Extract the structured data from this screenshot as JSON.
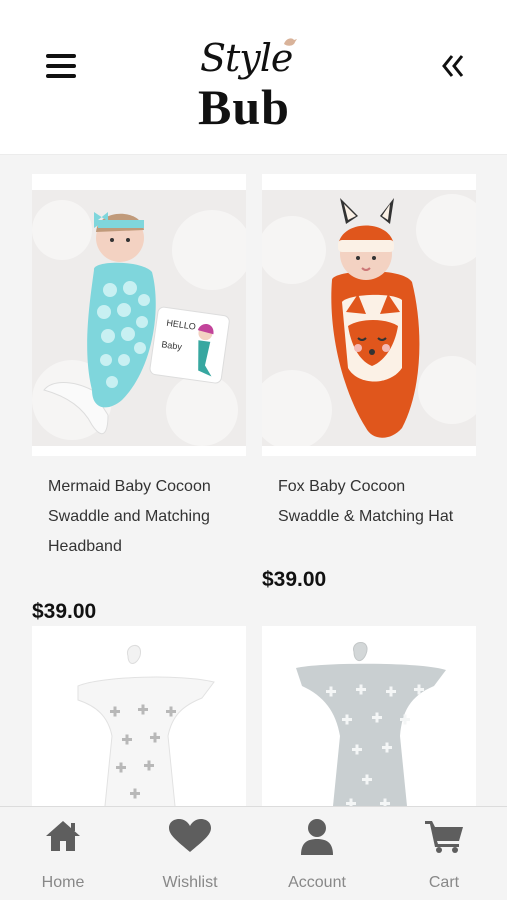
{
  "header": {
    "logo_script": "Style",
    "logo_bold": "Bub",
    "menu_icon": "hamburger-icon",
    "back_icon": "double-chevron-left-icon"
  },
  "products": [
    {
      "title_lines": [
        "Mermaid Baby Cocoon",
        "Swaddle and Matching",
        "Headband"
      ],
      "price": "$39.00",
      "image": "mermaid-cocoon-image",
      "card_label": "HELLO",
      "card_label2": "Baby"
    },
    {
      "title_lines": [
        "Fox Baby Cocoon",
        "Swaddle & Matching Hat"
      ],
      "price": "$39.00",
      "image": "fox-cocoon-image"
    },
    {
      "image": "white-star-sleeper-image"
    },
    {
      "image": "grey-star-sleeper-image"
    }
  ],
  "tabbar": {
    "items": [
      {
        "label": "Home",
        "icon": "home-icon"
      },
      {
        "label": "Wishlist",
        "icon": "heart-icon"
      },
      {
        "label": "Account",
        "icon": "user-icon"
      },
      {
        "label": "Cart",
        "icon": "cart-icon"
      }
    ]
  },
  "colors": {
    "teal": "#7fd6dc",
    "fox_orange": "#e0561c",
    "tab_icon": "#5e5e5e",
    "background": "#f4f4f4"
  }
}
